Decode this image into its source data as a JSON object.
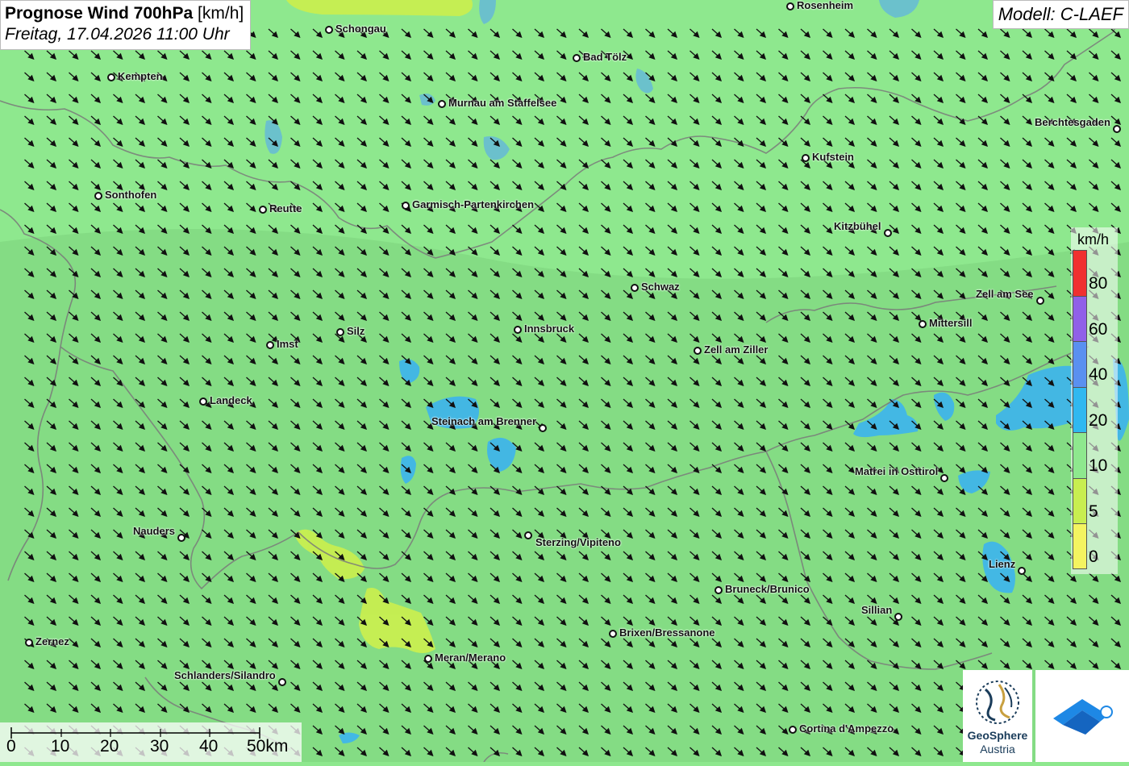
{
  "title": {
    "main": "Prognose Wind 700hPa",
    "unit": "[km/h]",
    "date": "Freitag, 17.04.2026 11:00 Uhr"
  },
  "model": "Modell: C-LAEF",
  "legend": {
    "unit": "km/h",
    "labels": [
      "80",
      "60",
      "40",
      "20",
      "10",
      "5",
      "0"
    ],
    "colors": [
      "#f03030",
      "#9060e8",
      "#5a90f0",
      "#30b8f0",
      "#8ee88e",
      "#c8ee50",
      "#f4f460"
    ]
  },
  "scale_bar": {
    "labels": [
      "0",
      "10",
      "20",
      "30",
      "40",
      "50km"
    ]
  },
  "logos": {
    "geosphere_line1": "GeoSphere",
    "geosphere_line2": "Austria"
  },
  "colors": {
    "calm_wind": "#8ee88e",
    "moderate_wind": "#30b8f0",
    "light_wind": "#c8ee50"
  },
  "cities": [
    {
      "name": "Rosenheim"
    },
    {
      "name": "Schongau"
    },
    {
      "name": "Bad Tölz"
    },
    {
      "name": "Kempten"
    },
    {
      "name": "Murnau am Staffelsee"
    },
    {
      "name": "Berchtesgaden"
    },
    {
      "name": "Kufstein"
    },
    {
      "name": "Sonthofen"
    },
    {
      "name": "Reutte"
    },
    {
      "name": "Garmisch-Partenkirchen"
    },
    {
      "name": "Kitzbühel"
    },
    {
      "name": "Schwaz"
    },
    {
      "name": "Zell am See"
    },
    {
      "name": "Mittersill"
    },
    {
      "name": "Silz"
    },
    {
      "name": "Innsbruck"
    },
    {
      "name": "Imst"
    },
    {
      "name": "Zell am Ziller"
    },
    {
      "name": "Landeck"
    },
    {
      "name": "Steinach am Brenner"
    },
    {
      "name": "Matrei in Osttirol"
    },
    {
      "name": "Nauders"
    },
    {
      "name": "Sterzing/Vipiteno"
    },
    {
      "name": "Lienz"
    },
    {
      "name": "Bruneck/Brunico"
    },
    {
      "name": "Sillian"
    },
    {
      "name": "Brixen/Bressanone"
    },
    {
      "name": "Zernez"
    },
    {
      "name": "Meran/Merano"
    },
    {
      "name": "Schlanders/Silandro"
    },
    {
      "name": "Cortina d'Ampezzo"
    }
  ]
}
